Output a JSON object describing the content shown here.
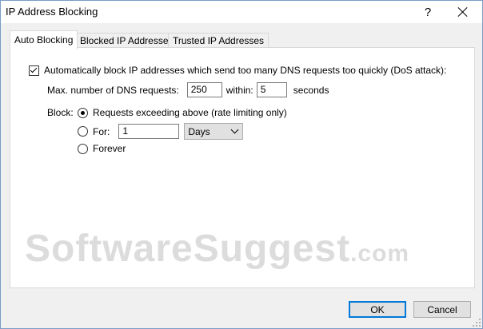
{
  "window": {
    "title": "IP Address Blocking",
    "help_glyph": "?"
  },
  "tabs": [
    {
      "label": "Auto Blocking",
      "active": true
    },
    {
      "label": "Blocked IP Addresses",
      "active": false
    },
    {
      "label": "Trusted IP Addresses",
      "active": false
    }
  ],
  "auto_blocking": {
    "enable_label": "Automatically block IP addresses which send too many DNS requests too quickly (DoS attack):",
    "enable_checked": true,
    "max_requests_label": "Max. number of DNS requests:",
    "max_requests_value": "250",
    "within_label": "within:",
    "within_value": "5",
    "seconds_label": "seconds",
    "block_label": "Block:",
    "block_options": [
      {
        "label": "Requests exceeding above (rate limiting only)",
        "selected": true
      },
      {
        "label": "For:",
        "selected": false
      },
      {
        "label": "Forever",
        "selected": false
      }
    ],
    "for_value": "1",
    "for_unit": "Days"
  },
  "watermark": {
    "text": "SoftwareSuggest",
    "tld": ".com"
  },
  "buttons": {
    "ok": "OK",
    "cancel": "Cancel"
  },
  "colors": {
    "accent": "#0078d7",
    "window_border": "#7a9cc8",
    "watermark": "#dcdcdc"
  }
}
